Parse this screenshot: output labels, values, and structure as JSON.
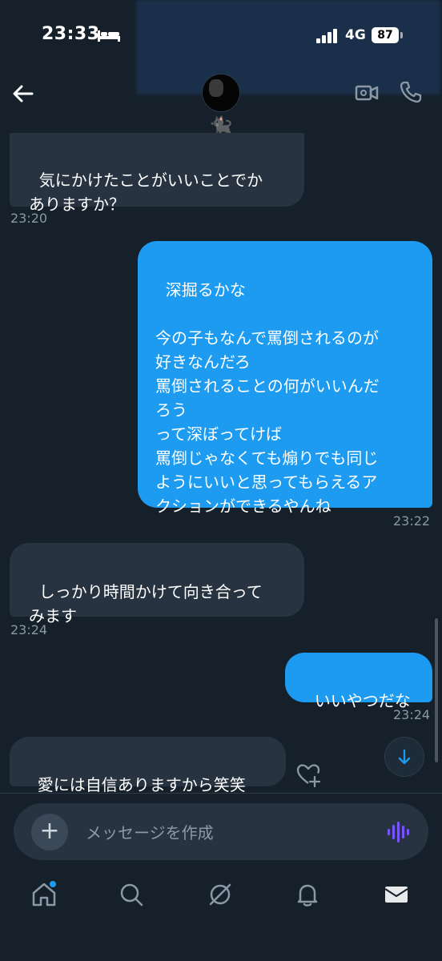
{
  "status_bar": {
    "time": "23:33",
    "network": "4G",
    "battery": "87"
  },
  "header": {
    "emoji": "🐈‍⬛",
    "icons": [
      "back-arrow-icon",
      "video-call-icon",
      "phone-icon"
    ]
  },
  "messages": [
    {
      "direction": "incoming",
      "text": "気にかけたことがいいことでか\nありますか？",
      "time": "23:20"
    },
    {
      "direction": "outgoing",
      "text": "深掘るかな\n\n今の子もなんで罵倒されるのが\n好きなんだろ\n罵倒されることの何がいいんだ\nろう\nって深ぼってけば\n罵倒じゃなくても煽りでも同じ\nようにいいと思ってもらえるア\nクションができるやんね",
      "time": "23:22"
    },
    {
      "direction": "incoming",
      "text": "しっかり時間かけて向き合って\nみます",
      "time": "23:24"
    },
    {
      "direction": "outgoing",
      "text": "いいやつだな",
      "time": "23:24"
    },
    {
      "direction": "incoming",
      "text": "愛には自信ありますから笑笑",
      "time": ""
    }
  ],
  "composer": {
    "placeholder": "メッセージを作成"
  },
  "tabs": [
    "home-icon",
    "search-icon",
    "grok-icon",
    "notifications-icon",
    "messages-icon"
  ],
  "colors": {
    "background": "#15202b",
    "incoming_bubble": "#273340",
    "outgoing_bubble": "#1d9bf0",
    "voice_accent": "#7856ff"
  }
}
